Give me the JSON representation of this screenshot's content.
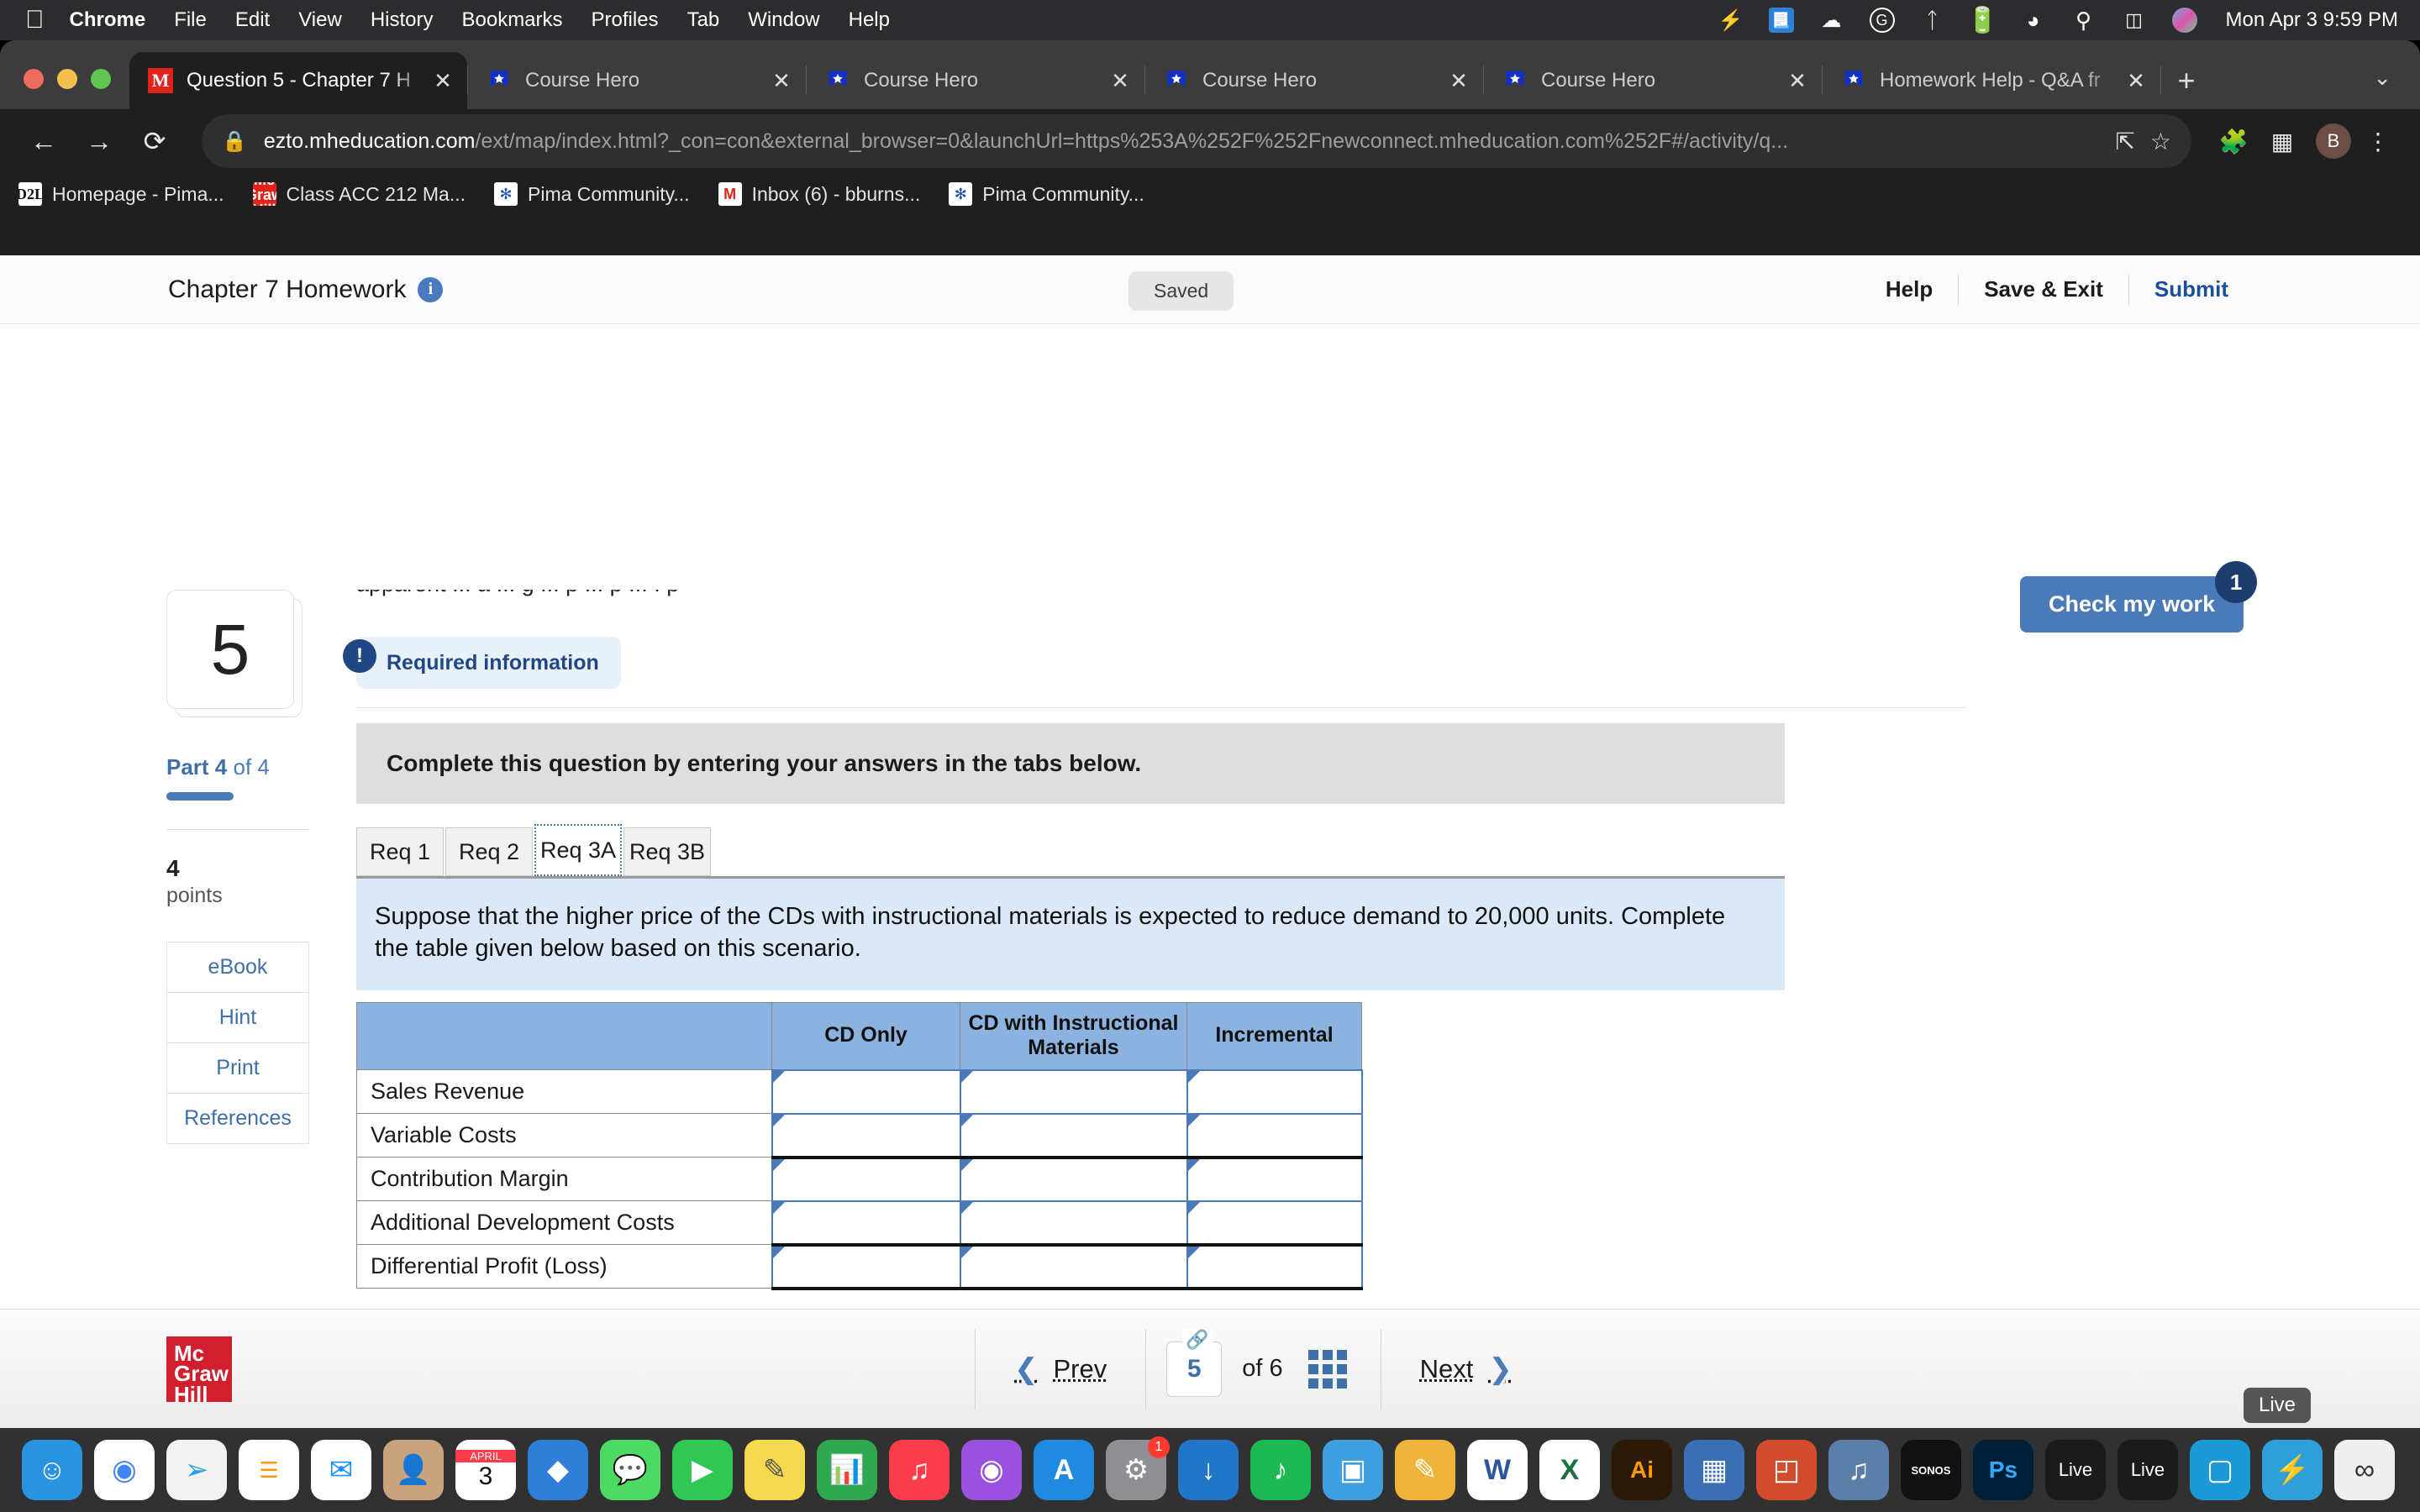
{
  "macos": {
    "apple_icon": "apple-icon",
    "menus": [
      "Chrome",
      "File",
      "Edit",
      "View",
      "History",
      "Bookmarks",
      "Profiles",
      "Tab",
      "Window",
      "Help"
    ],
    "status_icons": [
      "lightning-icon",
      "screenshot-icon",
      "cloud-icon",
      "grammarly-icon",
      "bluetooth-icon",
      "battery-icon",
      "wifi-icon",
      "search-icon",
      "control-center-icon",
      "siri-icon"
    ],
    "clock": "Mon Apr 3  9:59 PM"
  },
  "browser": {
    "tabs": [
      {
        "title": "Question 5 - Chapter 7 H",
        "favicon": "mcgraw-hill-icon",
        "active": true
      },
      {
        "title": "Course Hero",
        "favicon": "course-hero-icon",
        "active": false
      },
      {
        "title": "Course Hero",
        "favicon": "course-hero-icon",
        "active": false
      },
      {
        "title": "Course Hero",
        "favicon": "course-hero-icon",
        "active": false
      },
      {
        "title": "Course Hero",
        "favicon": "course-hero-icon",
        "active": false
      },
      {
        "title": "Homework Help - Q&A fr",
        "favicon": "course-hero-icon",
        "active": false
      }
    ],
    "new_tab_label": "+",
    "tab_close_label": "✕",
    "tab_list_chevron": "chevron-down-icon",
    "url_host": "ezto.mheducation.com",
    "url_rest": "/ext/map/index.html?_con=con&external_browser=0&launchUrl=https%253A%252F%252Fnewconnect.mheducation.com%252F#/activity/q...",
    "profile_initial": "B",
    "bookmarks": [
      {
        "label": "Homepage - Pima...",
        "icon": "d2l-icon",
        "icon_text": "D2L"
      },
      {
        "label": "Class ACC 212 Ma...",
        "icon": "mcgraw-hill-icon",
        "icon_text": "Mc Graw Hill"
      },
      {
        "label": "Pima Community...",
        "icon": "pima-icon",
        "icon_text": "✳"
      },
      {
        "label": "Inbox (6) - bburns...",
        "icon": "gmail-icon",
        "icon_text": "M"
      },
      {
        "label": "Pima Community...",
        "icon": "pima-icon",
        "icon_text": "✳"
      }
    ]
  },
  "app": {
    "header": {
      "title": "Chapter 7 Homework",
      "info_icon": "info-icon",
      "saved_status": "Saved",
      "help_label": "Help",
      "save_exit_label": "Save & Exit",
      "submit_label": "Submit"
    },
    "check_my_work": {
      "label": "Check my work",
      "badge": "1"
    },
    "sidebar": {
      "question_number": "5",
      "part_bold": "Part 4",
      "part_rest": " of 4",
      "points_value": "4",
      "points_label": "points",
      "links": [
        "eBook",
        "Hint",
        "Print",
        "References"
      ]
    },
    "main": {
      "clipped_text": "apparent ... a ... g ... p ...                                 p ...                                      .            p",
      "required_information": "Required information",
      "instruction_banner": "Complete this question by entering your answers in the tabs below.",
      "req_tabs": [
        {
          "label": "Req 1",
          "active": false
        },
        {
          "label": "Req 2",
          "active": false
        },
        {
          "label": "Req 3A",
          "active": true
        },
        {
          "label": "Req 3B",
          "active": false
        }
      ],
      "question_text": "Suppose that the higher price of the CDs with instructional materials is expected to reduce demand to 20,000 units. Complete the table given below based on this scenario.",
      "table": {
        "headers": [
          "",
          "CD Only",
          "CD with Instructional Materials",
          "Incremental"
        ],
        "rows": [
          {
            "label": "Sales Revenue",
            "values": [
              "",
              "",
              ""
            ]
          },
          {
            "label": "Variable Costs",
            "values": [
              "",
              "",
              ""
            ]
          },
          {
            "label": "Contribution Margin",
            "values": [
              "",
              "",
              ""
            ]
          },
          {
            "label": "Additional Development Costs",
            "values": [
              "",
              "",
              ""
            ]
          },
          {
            "label": "Differential Profit (Loss)",
            "values": [
              "",
              "",
              ""
            ]
          }
        ]
      },
      "prev_req_button": "Req 2",
      "next_req_button": "Req 3B",
      "prev_chevron": "‹",
      "next_chevron": "›"
    },
    "footer": {
      "logo_text": "Mc Graw Hill",
      "prev_label": "Prev",
      "next_label": "Next",
      "page_current": "5",
      "page_of": "of  6",
      "chain_icon": "link-icon",
      "grid_icon": "grid-icon"
    }
  },
  "dock": {
    "items": [
      {
        "name": "finder-icon",
        "color": "#2a93e0",
        "glyph": "🙂"
      },
      {
        "name": "chrome-icon",
        "color": "#ffffff",
        "glyph": "●"
      },
      {
        "name": "safari-icon",
        "color": "#1f9fe8",
        "glyph": "◉"
      },
      {
        "name": "reminders-icon",
        "color": "#ffffff",
        "glyph": "☰"
      },
      {
        "name": "mail-icon",
        "color": "#ffffff",
        "glyph": "✉"
      },
      {
        "name": "contacts-icon",
        "color": "#c9a27e",
        "glyph": "👤"
      },
      {
        "name": "calendar-icon",
        "color": "#ffffff",
        "glyph": "3"
      },
      {
        "name": "appstore-blue-icon",
        "color": "#2f7fd6",
        "glyph": "◆"
      },
      {
        "name": "messages-icon",
        "color": "#4cd964",
        "glyph": "💬"
      },
      {
        "name": "facetime-icon",
        "color": "#30c755",
        "glyph": "▶"
      },
      {
        "name": "notes-icon",
        "color": "#f5d94e",
        "glyph": "✎"
      },
      {
        "name": "numbers-icon",
        "color": "#2fa84f",
        "glyph": "📊"
      },
      {
        "name": "music-icon",
        "color": "#fa3c4c",
        "glyph": "♫"
      },
      {
        "name": "podcasts-icon",
        "color": "#9b51e0",
        "glyph": "◉"
      },
      {
        "name": "appstore-icon",
        "color": "#1f8ae0",
        "glyph": "A"
      },
      {
        "name": "system-settings-icon",
        "color": "#8e8e93",
        "glyph": "⚙",
        "badge": "1"
      },
      {
        "name": "app-store-update-icon",
        "color": "#2176c7",
        "glyph": "↓"
      },
      {
        "name": "spotify-icon",
        "color": "#1db954",
        "glyph": "♪"
      },
      {
        "name": "preview-icon",
        "color": "#3f9fe0",
        "glyph": "▣"
      },
      {
        "name": "paint-icon",
        "color": "#f0b33c",
        "glyph": "✏"
      },
      {
        "name": "word-icon",
        "color": "#2b579a",
        "glyph": "W"
      },
      {
        "name": "excel-icon",
        "color": "#1d6f42",
        "glyph": "X"
      },
      {
        "name": "illustrator-icon",
        "color": "#2b1a08",
        "glyph": "Ai"
      },
      {
        "name": "grid-app-icon",
        "color": "#3b6fb5",
        "glyph": "░"
      },
      {
        "name": "layers-icon",
        "color": "#4d4d4d",
        "glyph": "◰"
      },
      {
        "name": "audio-app-icon",
        "color": "#5b7fa8",
        "glyph": "♫"
      },
      {
        "name": "sonos-icon",
        "color": "#111111",
        "glyph": "SONOS"
      },
      {
        "name": "photoshop-icon",
        "color": "#001e36",
        "glyph": "Ps"
      },
      {
        "name": "live-icon-1",
        "color": "#1b1b1b",
        "glyph": "Live"
      },
      {
        "name": "live-icon-2",
        "color": "#1b1b1b",
        "glyph": "Live"
      },
      {
        "name": "box-icon",
        "color": "#1b9ad6",
        "glyph": "▢"
      },
      {
        "name": "flash-icon",
        "color": "#2f9fd8",
        "glyph": "⚡"
      },
      {
        "name": "infinity-icon",
        "color": "#efefef",
        "glyph": "∞"
      }
    ],
    "tooltip": "Live",
    "trash": "trash-icon"
  }
}
